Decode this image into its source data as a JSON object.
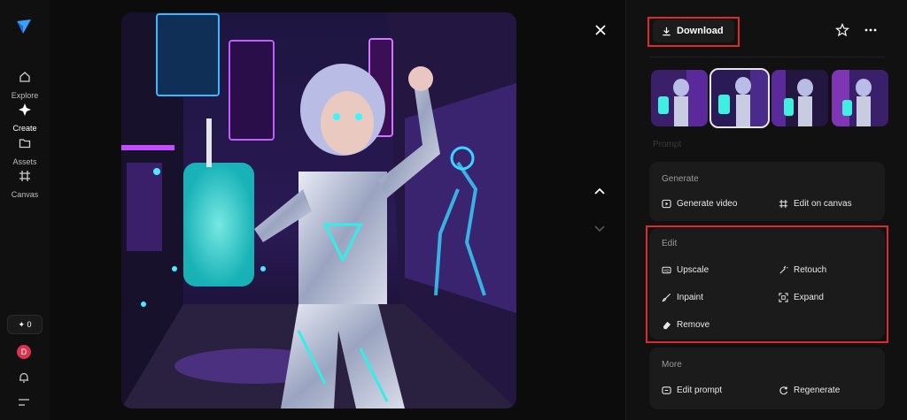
{
  "nav": {
    "items": [
      {
        "label": "Explore",
        "icon": "home-icon"
      },
      {
        "label": "Create",
        "icon": "sparkle-icon"
      },
      {
        "label": "Assets",
        "icon": "folder-icon"
      },
      {
        "label": "Canvas",
        "icon": "grid-icon"
      }
    ],
    "credits": "✦ 0",
    "avatar_initial": "D"
  },
  "panel": {
    "download_label": "Download",
    "faded_text": "Prompt",
    "generate": {
      "title": "Generate",
      "actions": [
        "Generate video",
        "Edit on canvas"
      ]
    },
    "edit": {
      "title": "Edit",
      "actions": [
        "Upscale",
        "Retouch",
        "Inpaint",
        "Expand",
        "Remove"
      ]
    },
    "more": {
      "title": "More",
      "actions": [
        "Edit prompt",
        "Regenerate"
      ]
    }
  },
  "colors": {
    "highlight": "#e0282e",
    "accent_blue": "#3aa0ff",
    "neon_purple": "#a24dff",
    "neon_cyan": "#27e6e6"
  }
}
